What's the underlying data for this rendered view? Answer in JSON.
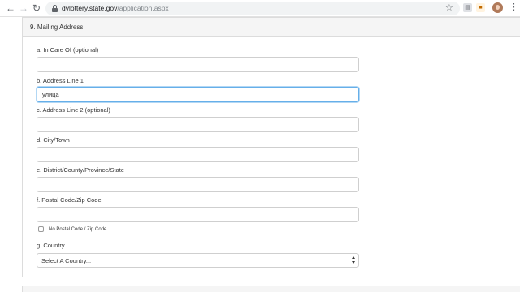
{
  "browser": {
    "url_host": "dvlottery.state.gov",
    "url_path": "/application.aspx",
    "back": "←",
    "forward": "→",
    "reload": "↻",
    "star": "☆",
    "menu": "⋮",
    "icons": [
      "back-icon",
      "forward-icon",
      "reload-icon",
      "lock-icon",
      "bookmark-star-icon",
      "extension-icon",
      "user-avatar-icon",
      "menu-icon"
    ]
  },
  "section": {
    "title": "9. Mailing Address"
  },
  "fields": {
    "care_of": {
      "label": "a. In Care Of (optional)",
      "value": ""
    },
    "address1": {
      "label": "b. Address Line 1",
      "value": "улица"
    },
    "address2": {
      "label": "c. Address Line 2 (optional)",
      "value": ""
    },
    "city": {
      "label": "d. City/Town",
      "value": ""
    },
    "district": {
      "label": "e. District/County/Province/State",
      "value": ""
    },
    "postal": {
      "label": "f. Postal Code/Zip Code",
      "value": ""
    },
    "no_postal": {
      "label": "No Postal Code / Zip Code",
      "checked": false
    },
    "country": {
      "label": "g. Country",
      "selected": "Select A Country..."
    }
  },
  "colors": {
    "focus_border": "#66afe9",
    "panel_heading_bg": "#f5f5f5",
    "border": "#dcdcdc"
  }
}
